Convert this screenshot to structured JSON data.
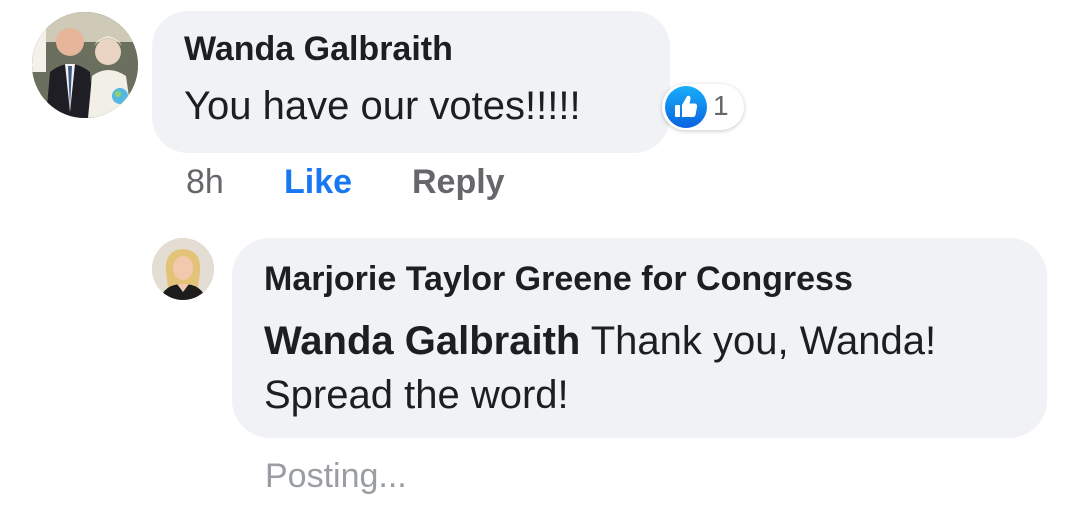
{
  "comment": {
    "author": "Wanda Galbraith",
    "text": "You have our votes!!!!!",
    "reaction_icon": "like-icon",
    "reaction_count": "1",
    "time": "8h",
    "like_label": "Like",
    "reply_label": "Reply"
  },
  "reply": {
    "author": "Marjorie Taylor Greene for Congress",
    "mention": "Wanda Galbraith",
    "text": " Thank you, Wanda! Spread the word!",
    "status": "Posting..."
  },
  "colors": {
    "bubble": "#f0f2f5",
    "link_blue": "#1877f2",
    "secondary_text": "#65676b"
  }
}
